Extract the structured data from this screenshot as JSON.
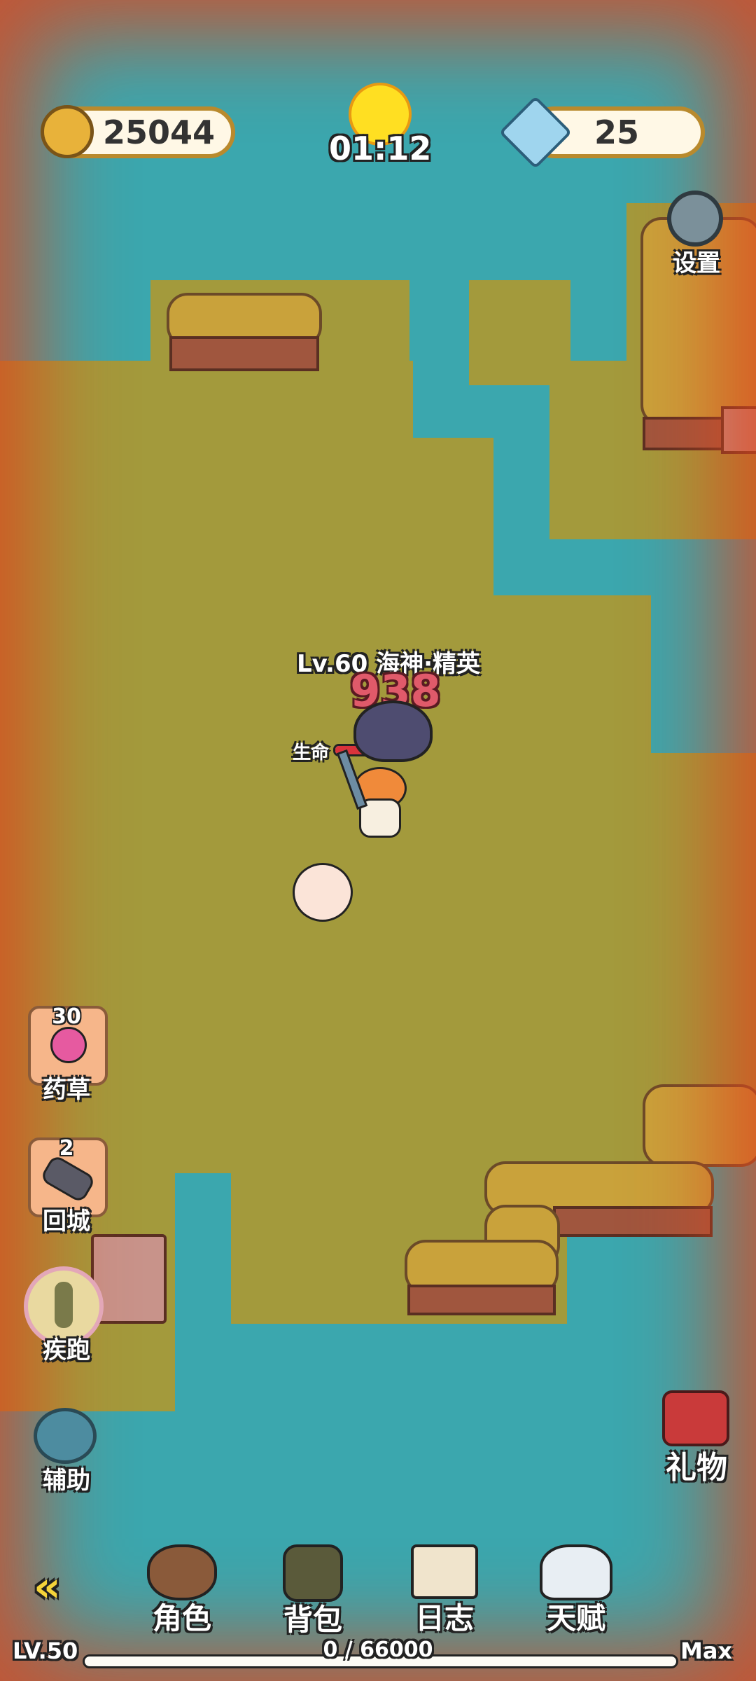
{
  "hud": {
    "gold": "25044",
    "gems": "25",
    "timer": "01:12",
    "settings_label": "设置"
  },
  "enemy": {
    "title": "Lv.60 海神·精英",
    "damage": "938",
    "hp_label": "生命",
    "hp_fraction": 0.75
  },
  "side_items": {
    "herb": {
      "count": "30",
      "label": "药草"
    },
    "town": {
      "count": "2",
      "label": "回城"
    },
    "sprint": {
      "label": "疾跑"
    },
    "assist": {
      "label": "辅助"
    }
  },
  "gift_label": "礼物",
  "bottom_nav": {
    "items": [
      {
        "label": "角色",
        "icon": "hero-icon"
      },
      {
        "label": "背包",
        "icon": "backpack-icon"
      },
      {
        "label": "日志",
        "icon": "journal-icon"
      },
      {
        "label": "天赋",
        "icon": "talent-icon"
      }
    ]
  },
  "xp": {
    "level": "LV.50",
    "progress": "0 / 66000",
    "max_label": "Max",
    "fraction": 0.0
  },
  "colors": {
    "water": "#3ba7ae",
    "grass": "#a39a3c",
    "danger_vignette": "#dc461e",
    "hp_bar": "#d9333b"
  }
}
